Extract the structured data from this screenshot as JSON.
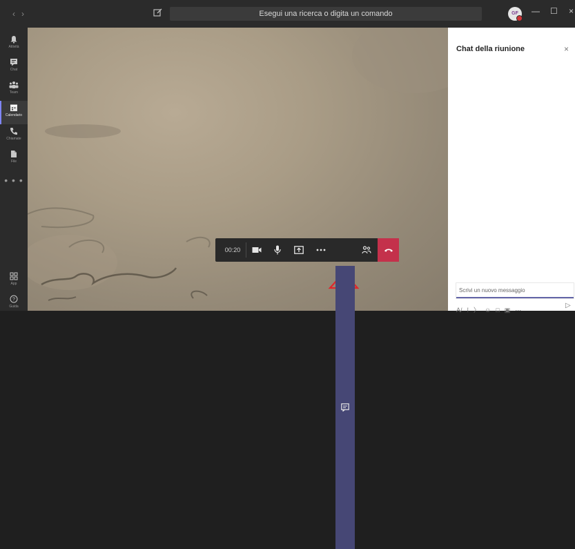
{
  "titlebar": {
    "back_icon": "chevron-left-icon",
    "forward_icon": "chevron-right-icon",
    "search_placeholder": "Esegui una ricerca o digita un comando",
    "avatar_initials": "GF",
    "minimize_glyph": "—",
    "maximize_glyph": "☐",
    "close_glyph": "×"
  },
  "rail": {
    "items": [
      {
        "label": "Attività",
        "icon": "bell-icon"
      },
      {
        "label": "Chat",
        "icon": "chat-icon"
      },
      {
        "label": "Team",
        "icon": "teams-icon"
      },
      {
        "label": "Calendario",
        "icon": "calendar-icon",
        "active": true
      },
      {
        "label": "Chiamate",
        "icon": "phone-icon"
      },
      {
        "label": "File",
        "icon": "file-icon"
      }
    ],
    "more": "• • •",
    "bottom": [
      {
        "label": "App",
        "icon": "apps-icon"
      },
      {
        "label": "Guida",
        "icon": "help-icon"
      }
    ]
  },
  "controls": {
    "timer": "00:20",
    "accent_colors": {
      "chat_active": "#464775",
      "hangup": "#c4314b",
      "arrow": "#e0262c"
    }
  },
  "chat": {
    "title": "Chat della riunione",
    "close_glyph": "×",
    "compose_placeholder": "Scrivi un nuovo messaggio"
  }
}
